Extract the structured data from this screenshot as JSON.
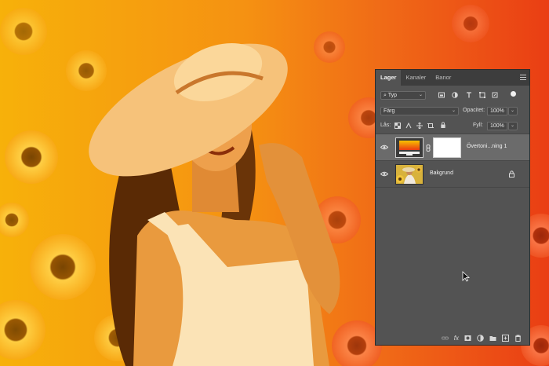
{
  "panel": {
    "tabs": [
      {
        "label": "Lager",
        "active": true
      },
      {
        "label": "Kanaler",
        "active": false
      },
      {
        "label": "Banor",
        "active": false
      }
    ],
    "filter": {
      "label": "Typ"
    },
    "blend_mode": "Färg",
    "opacity_label": "Opacitet:",
    "opacity_value": "100%",
    "lock_label": "Lås:",
    "fill_label": "Fyll:",
    "fill_value": "100%",
    "layers": [
      {
        "name": "Övertoni...ning 1",
        "selected": true,
        "visible": true,
        "type": "gradient-map-adjustment"
      },
      {
        "name": "Bakgrund",
        "selected": false,
        "visible": true,
        "locked": true,
        "type": "image"
      }
    ],
    "bottom_icons": [
      "link-icon",
      "fx-icon",
      "mask-icon",
      "adjustment-icon",
      "folder-icon",
      "new-layer-icon",
      "trash-icon"
    ]
  },
  "colors": {
    "gradient_start": "#f7b500",
    "gradient_end": "#ec3a12",
    "panel_bg": "#535353"
  }
}
